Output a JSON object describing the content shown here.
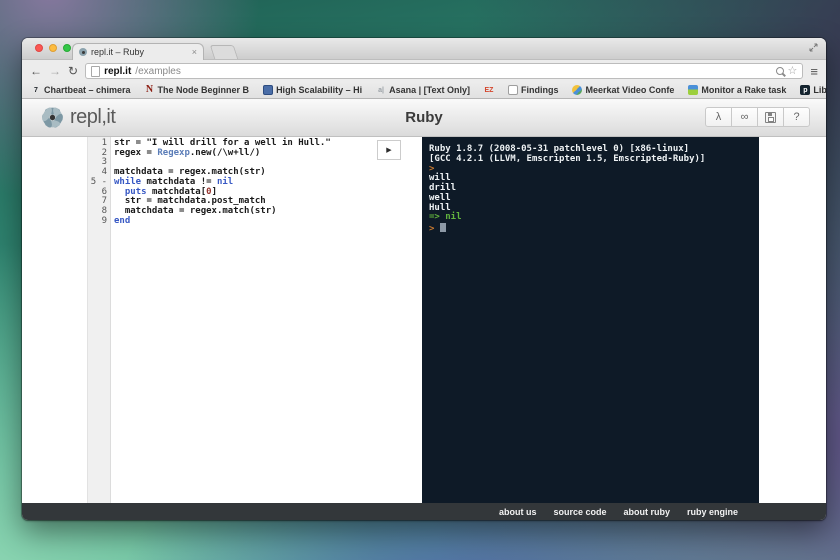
{
  "browser": {
    "tab": {
      "title": "repl.it – Ruby",
      "close_glyph": "×"
    },
    "toolbar": {
      "back_glyph": "←",
      "forward_glyph": "→",
      "reload_glyph": "↻",
      "url_main": "repl.it",
      "url_path": "/examples",
      "star_glyph": "☆",
      "menu_glyph": "≡"
    },
    "bookmarks": [
      {
        "label": "Chartbeat – chimera",
        "icon": "chartbeat-icon",
        "icon_text": "7",
        "icon_fg": "#23282d"
      },
      {
        "label": "The Node Beginner B",
        "icon": "node-beginner-icon",
        "icon_text": "N",
        "icon_fg": "#8c1d12"
      },
      {
        "label": "High Scalability – Hi",
        "icon": "high-scalability-icon",
        "icon_text": "",
        "icon_bg": "#4a6da7"
      },
      {
        "label": "Asana | [Text Only]",
        "icon": "asana-icon",
        "icon_text": "a|",
        "icon_fg": "#9aa0a6"
      },
      {
        "label": "",
        "icon": "ez-icon",
        "icon_text": "EZ",
        "icon_fg": "#d4452c"
      },
      {
        "label": "Findings",
        "icon": "findings-icon",
        "icon_text": "",
        "icon_bg": "#ffffff",
        "icon_border": "#9e9e9e"
      },
      {
        "label": "Meerkat Video Confe",
        "icon": "meerkat-icon",
        "icon_text": ""
      },
      {
        "label": "Monitor a Rake task",
        "icon": "rake-task-icon",
        "icon_text": ""
      },
      {
        "label": "Libraries \\ Processin",
        "icon": "processing-icon",
        "icon_text": "p",
        "icon_fg": "#ffffff",
        "icon_bg": "#14232e"
      }
    ],
    "bookmarks_overflow": "»"
  },
  "app": {
    "logo_text": "repl,it",
    "page_title": "Ruby",
    "header_buttons": [
      {
        "name": "lambda",
        "glyph": "λ"
      },
      {
        "name": "share",
        "glyph": "∞"
      },
      {
        "name": "save",
        "glyph": ""
      },
      {
        "name": "help",
        "glyph": "?"
      }
    ],
    "run_glyph": "▶"
  },
  "editor": {
    "lines": [
      {
        "num": "1",
        "segments": [
          {
            "t": "str = \"I will drill for a well in Hull.\"",
            "s": "plain"
          }
        ]
      },
      {
        "num": "2",
        "segments": [
          {
            "t": "regex = ",
            "s": "plain"
          },
          {
            "t": "Regexp",
            "s": "const"
          },
          {
            "t": ".new(/\\w+ll/)",
            "s": "plain"
          }
        ]
      },
      {
        "num": "3",
        "segments": []
      },
      {
        "num": "4",
        "segments": [
          {
            "t": "matchdata = regex.match(str)",
            "s": "plain"
          }
        ]
      },
      {
        "num": "5",
        "fold": true,
        "segments": [
          {
            "t": "while",
            "s": "kw"
          },
          {
            "t": " matchdata != ",
            "s": "plain"
          },
          {
            "t": "nil",
            "s": "kw"
          }
        ]
      },
      {
        "num": "6",
        "segments": [
          {
            "t": "  ",
            "s": "plain"
          },
          {
            "t": "puts",
            "s": "kw"
          },
          {
            "t": " matchdata[",
            "s": "plain"
          },
          {
            "t": "0",
            "s": "num"
          },
          {
            "t": "]",
            "s": "plain"
          }
        ]
      },
      {
        "num": "7",
        "segments": [
          {
            "t": "  str = matchdata.post_match",
            "s": "plain"
          }
        ]
      },
      {
        "num": "8",
        "segments": [
          {
            "t": "  matchdata = regex.match(str)",
            "s": "plain"
          }
        ]
      },
      {
        "num": "9",
        "segments": [
          {
            "t": "end",
            "s": "kw"
          }
        ]
      }
    ]
  },
  "console": {
    "lines": [
      {
        "segments": [
          {
            "t": "Ruby 1.8.7 (2008-05-31 patchlevel 0) [x86-linux]",
            "s": "out"
          }
        ]
      },
      {
        "segments": [
          {
            "t": "[GCC 4.2.1 (LLVM, Emscripten 1.5, Emscripted-Ruby)]",
            "s": "out"
          }
        ]
      },
      {
        "segments": [
          {
            "t": ">",
            "s": "prompt"
          }
        ]
      },
      {
        "segments": [
          {
            "t": "will",
            "s": "out"
          }
        ]
      },
      {
        "segments": [
          {
            "t": "drill",
            "s": "out"
          }
        ]
      },
      {
        "segments": [
          {
            "t": "well",
            "s": "out"
          }
        ]
      },
      {
        "segments": [
          {
            "t": "Hull",
            "s": "out"
          }
        ]
      },
      {
        "segments": [
          {
            "t": "=> nil",
            "s": "result"
          }
        ]
      },
      {
        "segments": [
          {
            "t": "> ",
            "s": "prompt"
          },
          {
            "t": "",
            "s": "cursor"
          }
        ]
      }
    ]
  },
  "footer": {
    "links": [
      "about us",
      "source code",
      "about ruby",
      "ruby engine"
    ]
  }
}
